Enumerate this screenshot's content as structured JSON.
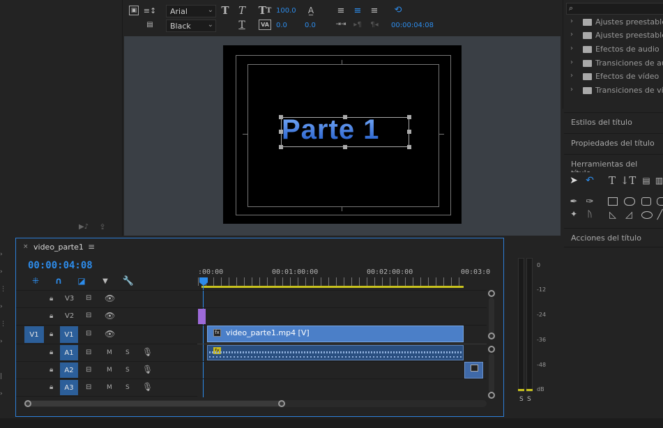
{
  "title_toolbar": {
    "font_family": "Arial",
    "font_style": "Black",
    "font_size": "100.0",
    "kerning": "0.0",
    "tracking": "0.0",
    "timecode": "00:00:04:08"
  },
  "program": {
    "title_text": "Parte 1"
  },
  "effects": {
    "items": [
      "Ajustes preestablecidos",
      "Ajustes preestablecidos",
      "Efectos de audio",
      "Transiciones de audio",
      "Efectos de vídeo",
      "Transiciones de vídeo"
    ]
  },
  "title_panels": {
    "styles": "Estilos del título",
    "properties": "Propiedades del título",
    "tools": "Herramientas del título",
    "actions": "Acciones del título"
  },
  "timeline": {
    "sequence_name": "video_parte1",
    "timecode": "00:00:04:08",
    "ruler": [
      ":00:00",
      "00:01:00:00",
      "00:02:00:00",
      "00:03:0"
    ],
    "tracks": {
      "v3": "V3",
      "v2": "V2",
      "v1_src": "V1",
      "v1": "V1",
      "a1": "A1",
      "a2": "A2",
      "a3": "A3",
      "m": "M",
      "s": "S"
    },
    "video_clip": "video_parte1.mp4 [V]",
    "fx": "fx"
  },
  "meter": {
    "scale": [
      "0",
      "-12",
      "-24",
      "-36",
      "-48",
      "dB"
    ],
    "solo": "S"
  }
}
